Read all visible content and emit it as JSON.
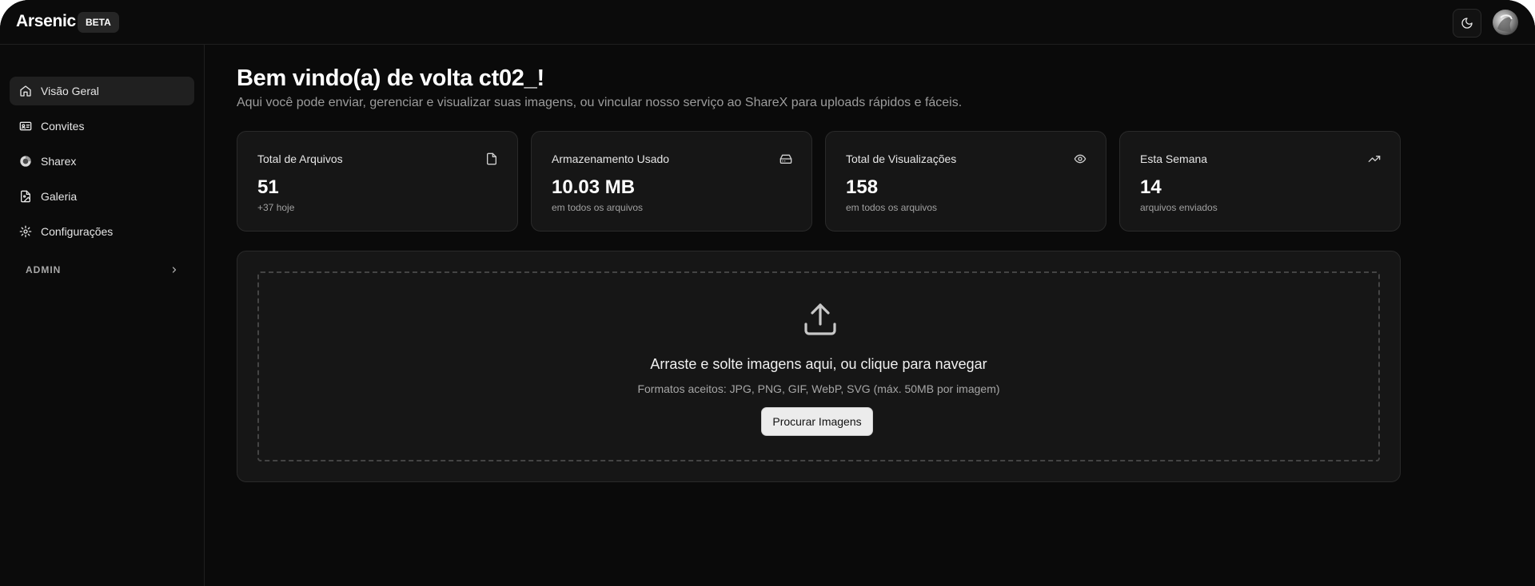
{
  "header": {
    "brand": "Arsenic",
    "badge": "BETA",
    "theme_toggle_icon": "moon-icon",
    "avatar_icon": "user-avatar"
  },
  "sidebar": {
    "items": [
      {
        "label": "Visão Geral",
        "icon": "home-icon",
        "active": true
      },
      {
        "label": "Convites",
        "icon": "id-card-icon",
        "active": false
      },
      {
        "label": "Sharex",
        "icon": "sharex-icon",
        "active": false
      },
      {
        "label": "Galeria",
        "icon": "image-file-icon",
        "active": false
      },
      {
        "label": "Configurações",
        "icon": "gear-icon",
        "active": false
      }
    ],
    "admin_label": "ADMIN"
  },
  "main": {
    "title": "Bem vindo(a) de volta ct02_!",
    "subtitle": "Aqui você pode enviar, gerenciar e visualizar suas imagens, ou vincular nosso serviço ao ShareX para uploads rápidos e fáceis.",
    "stats": [
      {
        "title": "Total de Arquivos",
        "value": "51",
        "note": "+37 hoje",
        "icon": "file-icon"
      },
      {
        "title": "Armazenamento Usado",
        "value": "10.03 MB",
        "note": "em todos os arquivos",
        "icon": "hard-drive-icon"
      },
      {
        "title": "Total de Visualizações",
        "value": "158",
        "note": "em todos os arquivos",
        "icon": "eye-icon"
      },
      {
        "title": "Esta Semana",
        "value": "14",
        "note": "arquivos enviados",
        "icon": "trending-up-icon"
      }
    ],
    "upload": {
      "icon": "upload-icon",
      "main_text": "Arraste e solte imagens aqui, ou clique para navegar",
      "formats_text": "Formatos aceitos: JPG, PNG, GIF, WebP, SVG (máx. 50MB por imagem)",
      "button_label": "Procurar Imagens"
    }
  },
  "colors": {
    "background": "#0a0a0a",
    "card": "#161616",
    "border": "#2a2a2a",
    "text": "#ffffff",
    "muted": "#a0a0a0",
    "active_nav": "#202020"
  }
}
